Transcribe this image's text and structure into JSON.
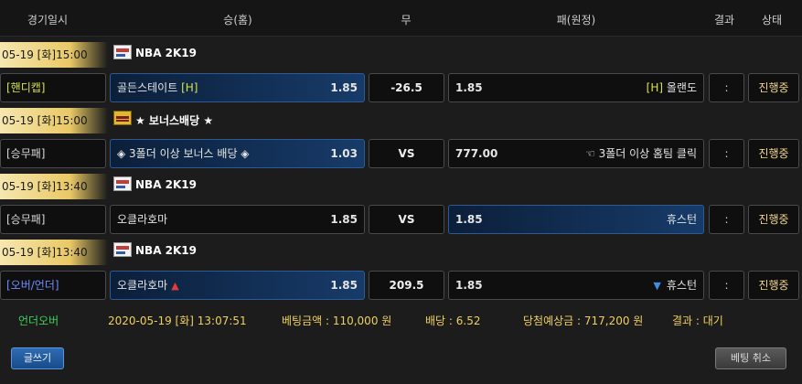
{
  "header": {
    "date": "경기일시",
    "home": "승(홈)",
    "draw": "무",
    "away": "패(원정)",
    "result": "결과",
    "status": "상태"
  },
  "matches": [
    {
      "datetime": "05-19 [화]15:00",
      "league": "NBA 2K19",
      "league_icon": "nba-2k19-logo-icon",
      "bet_type": "[핸디캡]",
      "home_team": "골든스테이트",
      "home_tag": "[H]",
      "home_odds": "1.85",
      "draw": "-26.5",
      "away_odds": "1.85",
      "away_tag": "[H]",
      "away_team": "올랜도",
      "result": ":",
      "status": "진행중",
      "selected": "home"
    },
    {
      "datetime": "05-19 [화]15:00",
      "league": "★ 보너스배당 ★",
      "league_icon": "bonus-logo-icon",
      "bet_type": "[승무패]",
      "home_team": "◈ 3폴더 이상 보너스 배당 ◈",
      "home_odds": "1.03",
      "draw": "VS",
      "away_odds": "777.00",
      "away_team": "☜ 3폴더 이상 홈팀 클릭",
      "result": ":",
      "status": "진행중",
      "selected": "home"
    },
    {
      "datetime": "05-19 [화]13:40",
      "league": "NBA 2K19",
      "league_icon": "nba-2k19-logo-icon",
      "bet_type": "[승무패]",
      "home_team": "오클라호마",
      "home_odds": "1.85",
      "draw": "VS",
      "away_odds": "1.85",
      "away_team": "휴스턴",
      "result": ":",
      "status": "진행중",
      "selected": "away"
    },
    {
      "datetime": "05-19 [화]13:40",
      "league": "NBA 2K19",
      "league_icon": "nba-2k19-logo-icon",
      "bet_type": "[오버/언더]",
      "home_team": "오클라호마",
      "home_odds": "1.85",
      "home_arrow": "▲",
      "draw": "209.5",
      "away_odds": "1.85",
      "away_arrow": "▼",
      "away_team": "휴스턴",
      "result": ":",
      "status": "진행중",
      "selected": "home"
    }
  ],
  "summary": {
    "type": "언더오버",
    "datetime": "2020-05-19 [화] 13:07:51",
    "bet_amount": "베팅금액 : 110,000 원",
    "odds": "배당 : 6.52",
    "expected_win": "당첨예상금 : 717,200 원",
    "result": "결과 : 대기"
  },
  "buttons": {
    "write": "글쓰기",
    "cancel": "베팅 취소"
  },
  "colors": {
    "date_tab_gold": "#e9c865",
    "selected_blue": "#173b69",
    "type_green": "#d6e44a",
    "type_blue": "#6f8cff",
    "status_gold": "#f0d48a",
    "summary_green": "#3fd25a",
    "summary_yellow": "#f0d060"
  }
}
